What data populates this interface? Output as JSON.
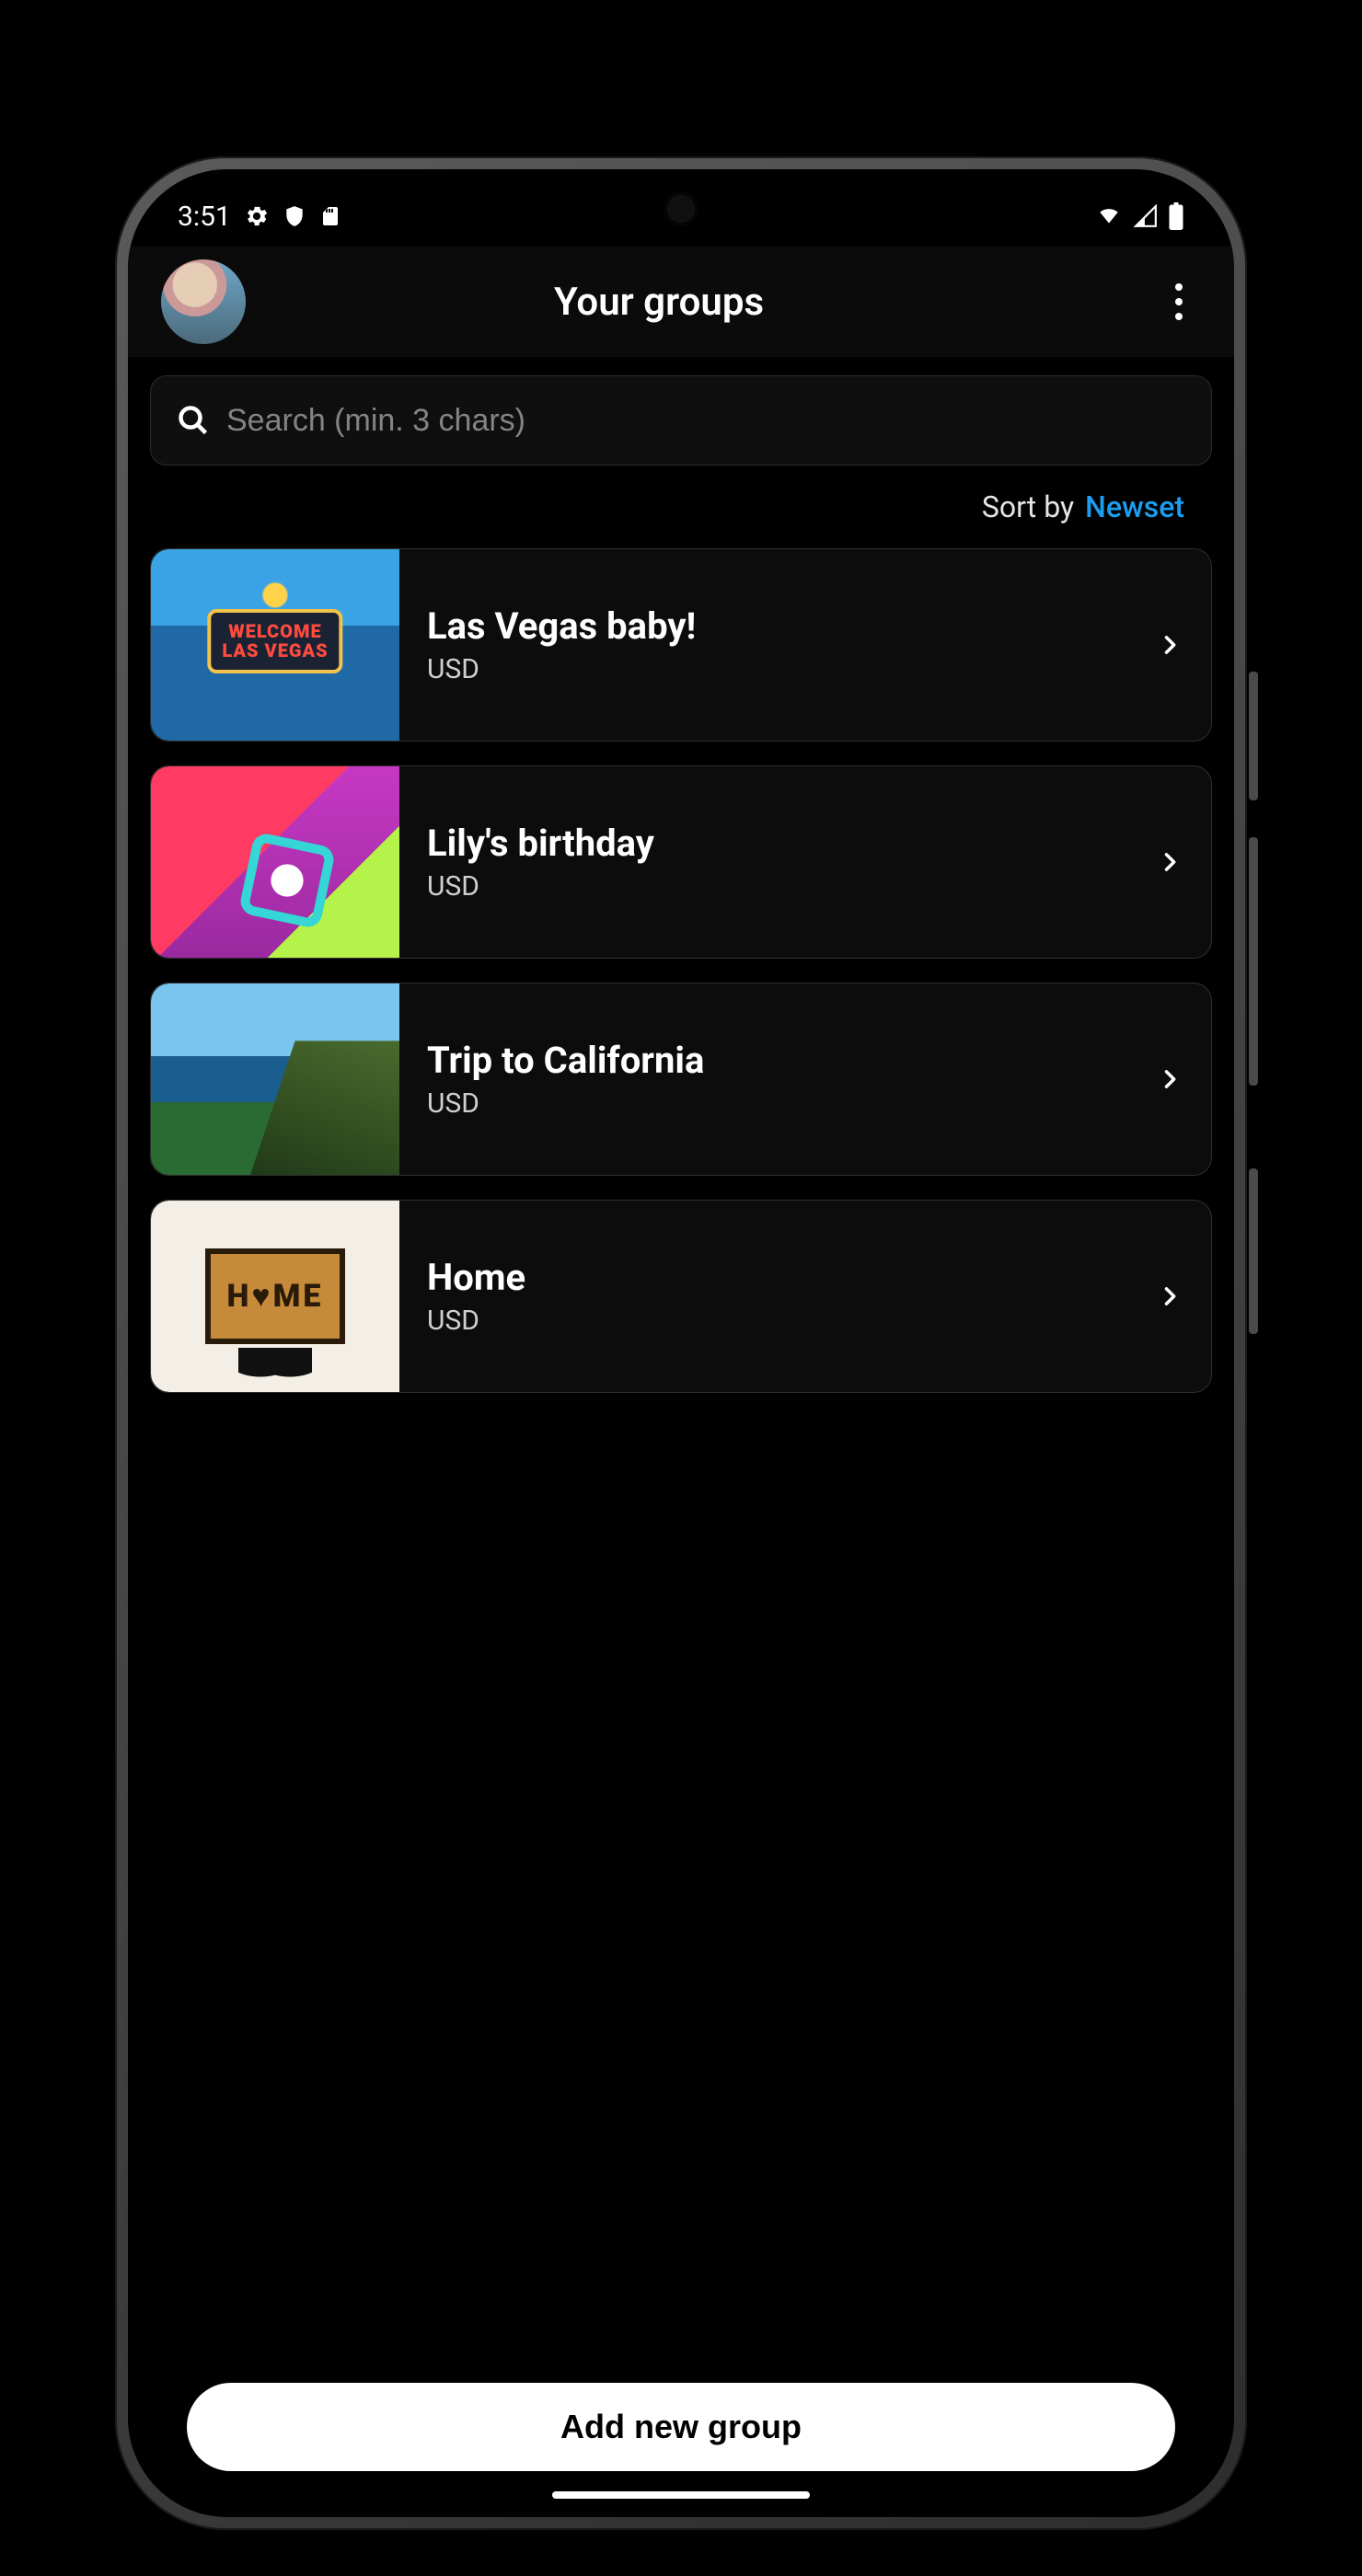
{
  "status": {
    "time": "3:51"
  },
  "header": {
    "title": "Your groups"
  },
  "search": {
    "placeholder": "Search (min. 3 chars)"
  },
  "sort": {
    "label": "Sort by",
    "value": "Newset"
  },
  "groups": [
    {
      "name": "Las Vegas baby!",
      "currency": "USD",
      "thumb": "vegas"
    },
    {
      "name": "Lily's birthday",
      "currency": "USD",
      "thumb": "gifts"
    },
    {
      "name": "Trip to California",
      "currency": "USD",
      "thumb": "cali"
    },
    {
      "name": "Home",
      "currency": "USD",
      "thumb": "home"
    }
  ],
  "footer": {
    "add_label": "Add new group"
  },
  "colors": {
    "accent": "#1b9ef0"
  }
}
